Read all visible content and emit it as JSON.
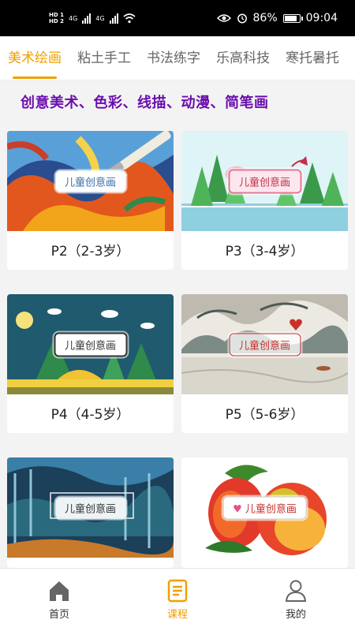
{
  "status_bar": {
    "hd1": "HD 1",
    "hd2": "HD 2",
    "net1": "4G",
    "net2": "4G",
    "battery": "86%",
    "battery_level": 0.86,
    "time": "09:04"
  },
  "tabs": [
    {
      "label": "美术绘画",
      "active": true
    },
    {
      "label": "粘土手工",
      "active": false
    },
    {
      "label": "书法练字",
      "active": false
    },
    {
      "label": "乐高科技",
      "active": false
    },
    {
      "label": "寒托暑托",
      "active": false
    }
  ],
  "subtitle": "创意美术、色彩、线描、动漫、简笔画",
  "courses": [
    {
      "label": "P2（2-3岁）",
      "badge": "儿童创意画"
    },
    {
      "label": "P3（3-4岁）",
      "badge": "儿童创意画"
    },
    {
      "label": "P4（4-5岁）",
      "badge": "儿童创意画"
    },
    {
      "label": "P5（5-6岁）",
      "badge": "儿童创意画"
    },
    {
      "label": "",
      "badge": "儿童创意画"
    },
    {
      "label": "",
      "badge": "儿童创意画"
    }
  ],
  "bottom_nav": [
    {
      "label": "首页",
      "icon": "home-icon",
      "active": false
    },
    {
      "label": "课程",
      "icon": "course-book-icon",
      "active": true
    },
    {
      "label": "我的",
      "icon": "user-icon",
      "active": false
    }
  ],
  "colors": {
    "accent": "#f0a000",
    "subtitle": "#6a0dad"
  }
}
